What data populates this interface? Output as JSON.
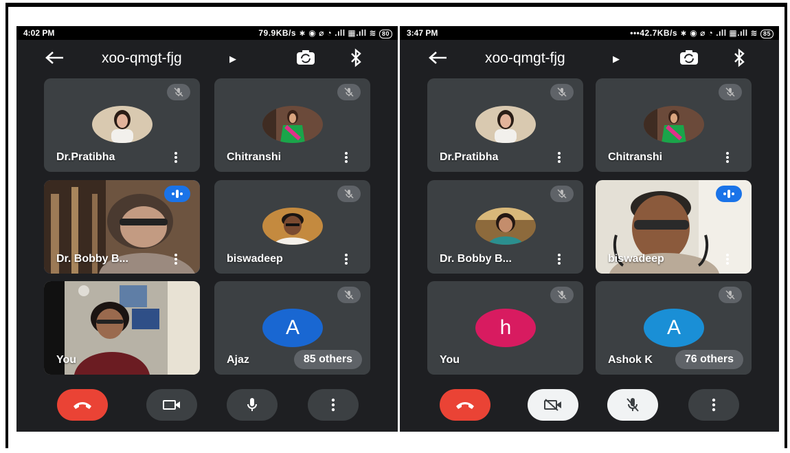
{
  "left": {
    "status": {
      "time": "4:02 PM",
      "network": "79.9KB/s ∗ ◉ ⌀ ◔ .ıll ▦.ıll ≋",
      "battery": "80"
    },
    "meeting_code": "xoo-qmgt-fjg",
    "tiles": [
      {
        "name": "Dr.Pratibha",
        "muted": true
      },
      {
        "name": "Chitranshi",
        "muted": true
      },
      {
        "name": "Dr. Bobby B...",
        "muted": false,
        "speaking": true
      },
      {
        "name": "biswadeep",
        "muted": true
      },
      {
        "name": "You",
        "muted": false
      },
      {
        "name": "Ajaz",
        "muted": true,
        "avatar_letter": "A",
        "avatar_color": "#1967d2",
        "others": "85 others"
      }
    ],
    "controls": [
      "end-call",
      "camera",
      "microphone",
      "more"
    ]
  },
  "right": {
    "status": {
      "time": "3:47 PM",
      "network": "•••42.7KB/s ∗ ◉ ⌀ ◔ .ıll ▦.ıll ≋",
      "battery": "85"
    },
    "meeting_code": "xoo-qmgt-fjg",
    "tiles": [
      {
        "name": "Dr.Pratibha",
        "muted": true
      },
      {
        "name": "Chitranshi",
        "muted": true
      },
      {
        "name": "Dr. Bobby B...",
        "muted": true
      },
      {
        "name": "biswadeep",
        "muted": false,
        "speaking": true
      },
      {
        "name": "You",
        "muted": true,
        "avatar_letter": "h",
        "avatar_color": "#d81b60"
      },
      {
        "name": "Ashok K",
        "muted": true,
        "avatar_letter": "A",
        "avatar_color": "#1a8fd6",
        "others": "76 others"
      }
    ],
    "controls": [
      "end-call",
      "camera-off",
      "microphone-off",
      "more"
    ]
  },
  "colors": {
    "end_call": "#ea4335",
    "tile": "#3c4043",
    "background": "#1e1f22",
    "accent": "#1a73e8"
  }
}
